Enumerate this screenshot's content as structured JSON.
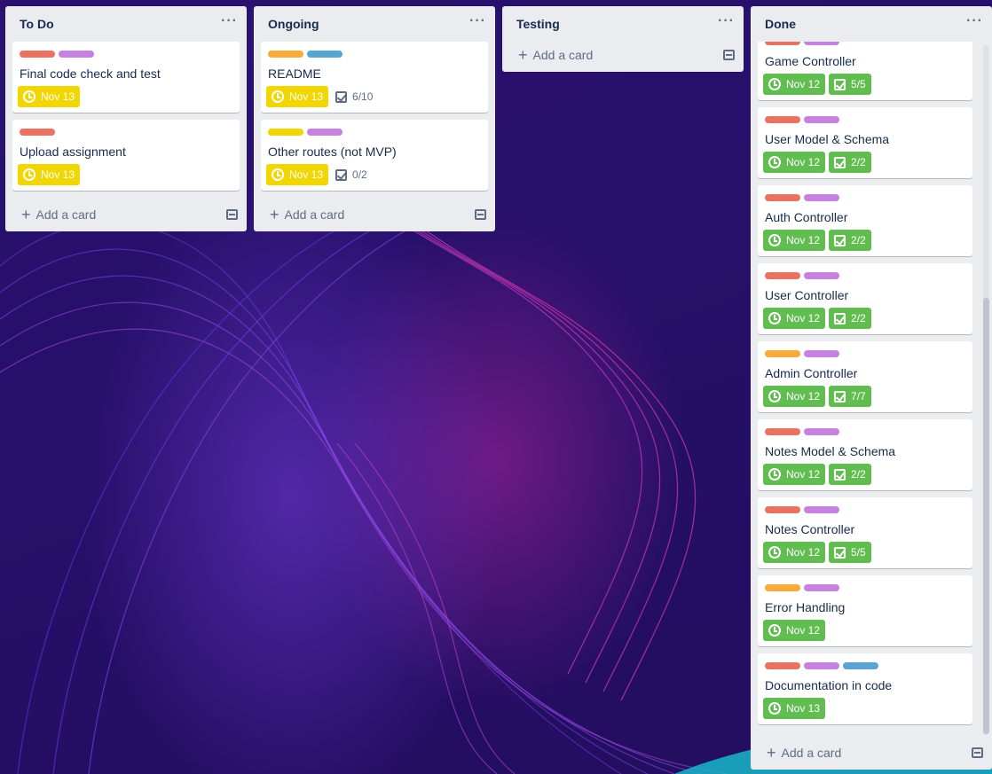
{
  "colors": {
    "label_red": "#eb7163",
    "label_purple": "#c781e0",
    "label_orange": "#f8ab3a",
    "label_blue": "#5aa4d1",
    "label_yellow": "#f2d600",
    "due_yellow": "#f2d600",
    "complete_green": "#61bd4f"
  },
  "lists": [
    {
      "title": "To Do",
      "menu": "···",
      "add_label": "Add a card",
      "cards": [
        {
          "labels": [
            "red",
            "purple"
          ],
          "title": "Final code check and test",
          "due": "Nov 13",
          "checklist": ""
        },
        {
          "labels": [
            "red"
          ],
          "title": "Upload assignment",
          "due": "Nov 13",
          "checklist": ""
        }
      ]
    },
    {
      "title": "Ongoing",
      "menu": "···",
      "add_label": "Add a card",
      "cards": [
        {
          "labels": [
            "orange",
            "blue"
          ],
          "title": "README",
          "due": "Nov 13",
          "checklist": "6/10"
        },
        {
          "labels": [
            "yellow",
            "purple"
          ],
          "title": "Other routes (not MVP)",
          "due": "Nov 13",
          "checklist": "0/2"
        }
      ]
    },
    {
      "title": "Testing",
      "menu": "···",
      "add_label": "Add a card",
      "cards": []
    },
    {
      "title": "Done",
      "menu": "···",
      "add_label": "Add a card",
      "cards": [
        {
          "labels": [
            "red",
            "purple"
          ],
          "title": "Game Controller",
          "due": "Nov 12",
          "checklist": "5/5"
        },
        {
          "labels": [
            "red",
            "purple"
          ],
          "title": "User Model & Schema",
          "due": "Nov 12",
          "checklist": "2/2"
        },
        {
          "labels": [
            "red",
            "purple"
          ],
          "title": "Auth Controller",
          "due": "Nov 12",
          "checklist": "2/2"
        },
        {
          "labels": [
            "red",
            "purple"
          ],
          "title": "User Controller",
          "due": "Nov 12",
          "checklist": "2/2"
        },
        {
          "labels": [
            "orange",
            "purple"
          ],
          "title": "Admin Controller",
          "due": "Nov 12",
          "checklist": "7/7"
        },
        {
          "labels": [
            "red",
            "purple"
          ],
          "title": "Notes Model & Schema",
          "due": "Nov 12",
          "checklist": "2/2"
        },
        {
          "labels": [
            "red",
            "purple"
          ],
          "title": "Notes Controller",
          "due": "Nov 12",
          "checklist": "5/5"
        },
        {
          "labels": [
            "orange",
            "purple"
          ],
          "title": "Error Handling",
          "due": "Nov 12",
          "checklist": ""
        },
        {
          "labels": [
            "red",
            "purple",
            "blue"
          ],
          "title": "Documentation in code",
          "due": "Nov 13",
          "checklist": ""
        }
      ]
    }
  ]
}
